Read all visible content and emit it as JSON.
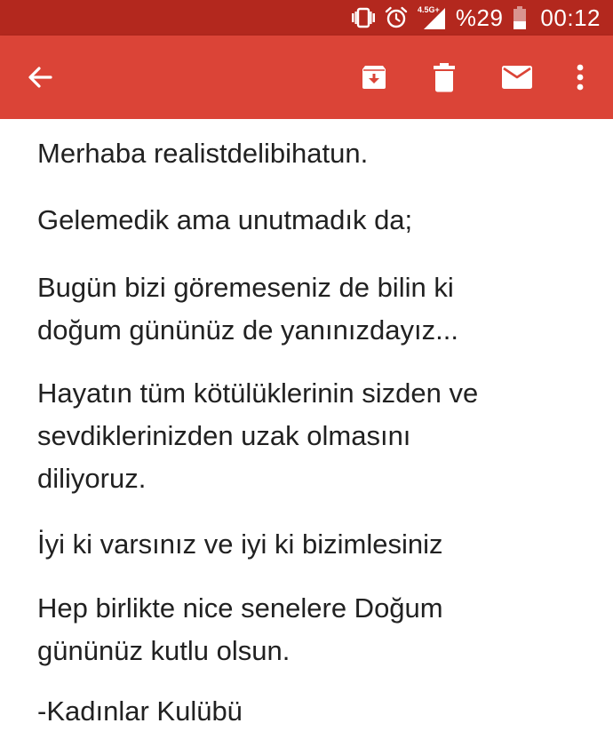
{
  "status_bar": {
    "network_label": "4.5G+",
    "battery_percent": "%29",
    "clock": "00:12",
    "icons": [
      "vibrate-icon",
      "alarm-icon",
      "signal-icon",
      "battery-icon"
    ]
  },
  "toolbar": {
    "background_color": "#db4437",
    "status_bar_color": "#b3281e",
    "back_icon": "arrow-back-icon",
    "actions": [
      "archive-icon",
      "delete-icon",
      "mark-unread-icon",
      "more-vert-icon"
    ]
  },
  "message": {
    "paragraphs": [
      "Merhaba realistdelibihatun.",
      "Gelemedik ama unutmadık da;",
      "Bugün bizi göremeseniz de bilin ki\ndoğum gününüz de yanınızdayız...",
      "Hayatın tüm kötülüklerinin sizden ve\nsevdiklerinizden uzak olmasını\ndiliyoruz.",
      "İyi ki varsınız ve iyi ki bizimlesiniz",
      "Hep birlikte nice senelere Doğum\ngününüz kutlu olsun.",
      "-Kadınlar Kulübü"
    ]
  }
}
